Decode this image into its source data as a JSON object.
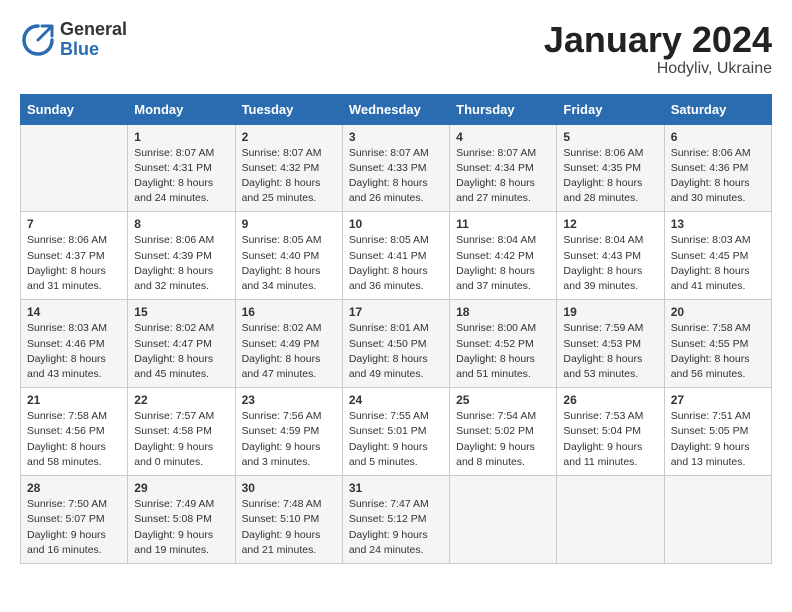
{
  "logo": {
    "general": "General",
    "blue": "Blue"
  },
  "title": {
    "month": "January 2024",
    "location": "Hodyliv, Ukraine"
  },
  "weekdays": [
    "Sunday",
    "Monday",
    "Tuesday",
    "Wednesday",
    "Thursday",
    "Friday",
    "Saturday"
  ],
  "weeks": [
    [
      {
        "day": "",
        "info": ""
      },
      {
        "day": "1",
        "info": "Sunrise: 8:07 AM\nSunset: 4:31 PM\nDaylight: 8 hours\nand 24 minutes."
      },
      {
        "day": "2",
        "info": "Sunrise: 8:07 AM\nSunset: 4:32 PM\nDaylight: 8 hours\nand 25 minutes."
      },
      {
        "day": "3",
        "info": "Sunrise: 8:07 AM\nSunset: 4:33 PM\nDaylight: 8 hours\nand 26 minutes."
      },
      {
        "day": "4",
        "info": "Sunrise: 8:07 AM\nSunset: 4:34 PM\nDaylight: 8 hours\nand 27 minutes."
      },
      {
        "day": "5",
        "info": "Sunrise: 8:06 AM\nSunset: 4:35 PM\nDaylight: 8 hours\nand 28 minutes."
      },
      {
        "day": "6",
        "info": "Sunrise: 8:06 AM\nSunset: 4:36 PM\nDaylight: 8 hours\nand 30 minutes."
      }
    ],
    [
      {
        "day": "7",
        "info": "Sunrise: 8:06 AM\nSunset: 4:37 PM\nDaylight: 8 hours\nand 31 minutes."
      },
      {
        "day": "8",
        "info": "Sunrise: 8:06 AM\nSunset: 4:39 PM\nDaylight: 8 hours\nand 32 minutes."
      },
      {
        "day": "9",
        "info": "Sunrise: 8:05 AM\nSunset: 4:40 PM\nDaylight: 8 hours\nand 34 minutes."
      },
      {
        "day": "10",
        "info": "Sunrise: 8:05 AM\nSunset: 4:41 PM\nDaylight: 8 hours\nand 36 minutes."
      },
      {
        "day": "11",
        "info": "Sunrise: 8:04 AM\nSunset: 4:42 PM\nDaylight: 8 hours\nand 37 minutes."
      },
      {
        "day": "12",
        "info": "Sunrise: 8:04 AM\nSunset: 4:43 PM\nDaylight: 8 hours\nand 39 minutes."
      },
      {
        "day": "13",
        "info": "Sunrise: 8:03 AM\nSunset: 4:45 PM\nDaylight: 8 hours\nand 41 minutes."
      }
    ],
    [
      {
        "day": "14",
        "info": "Sunrise: 8:03 AM\nSunset: 4:46 PM\nDaylight: 8 hours\nand 43 minutes."
      },
      {
        "day": "15",
        "info": "Sunrise: 8:02 AM\nSunset: 4:47 PM\nDaylight: 8 hours\nand 45 minutes."
      },
      {
        "day": "16",
        "info": "Sunrise: 8:02 AM\nSunset: 4:49 PM\nDaylight: 8 hours\nand 47 minutes."
      },
      {
        "day": "17",
        "info": "Sunrise: 8:01 AM\nSunset: 4:50 PM\nDaylight: 8 hours\nand 49 minutes."
      },
      {
        "day": "18",
        "info": "Sunrise: 8:00 AM\nSunset: 4:52 PM\nDaylight: 8 hours\nand 51 minutes."
      },
      {
        "day": "19",
        "info": "Sunrise: 7:59 AM\nSunset: 4:53 PM\nDaylight: 8 hours\nand 53 minutes."
      },
      {
        "day": "20",
        "info": "Sunrise: 7:58 AM\nSunset: 4:55 PM\nDaylight: 8 hours\nand 56 minutes."
      }
    ],
    [
      {
        "day": "21",
        "info": "Sunrise: 7:58 AM\nSunset: 4:56 PM\nDaylight: 8 hours\nand 58 minutes."
      },
      {
        "day": "22",
        "info": "Sunrise: 7:57 AM\nSunset: 4:58 PM\nDaylight: 9 hours\nand 0 minutes."
      },
      {
        "day": "23",
        "info": "Sunrise: 7:56 AM\nSunset: 4:59 PM\nDaylight: 9 hours\nand 3 minutes."
      },
      {
        "day": "24",
        "info": "Sunrise: 7:55 AM\nSunset: 5:01 PM\nDaylight: 9 hours\nand 5 minutes."
      },
      {
        "day": "25",
        "info": "Sunrise: 7:54 AM\nSunset: 5:02 PM\nDaylight: 9 hours\nand 8 minutes."
      },
      {
        "day": "26",
        "info": "Sunrise: 7:53 AM\nSunset: 5:04 PM\nDaylight: 9 hours\nand 11 minutes."
      },
      {
        "day": "27",
        "info": "Sunrise: 7:51 AM\nSunset: 5:05 PM\nDaylight: 9 hours\nand 13 minutes."
      }
    ],
    [
      {
        "day": "28",
        "info": "Sunrise: 7:50 AM\nSunset: 5:07 PM\nDaylight: 9 hours\nand 16 minutes."
      },
      {
        "day": "29",
        "info": "Sunrise: 7:49 AM\nSunset: 5:08 PM\nDaylight: 9 hours\nand 19 minutes."
      },
      {
        "day": "30",
        "info": "Sunrise: 7:48 AM\nSunset: 5:10 PM\nDaylight: 9 hours\nand 21 minutes."
      },
      {
        "day": "31",
        "info": "Sunrise: 7:47 AM\nSunset: 5:12 PM\nDaylight: 9 hours\nand 24 minutes."
      },
      {
        "day": "",
        "info": ""
      },
      {
        "day": "",
        "info": ""
      },
      {
        "day": "",
        "info": ""
      }
    ]
  ]
}
